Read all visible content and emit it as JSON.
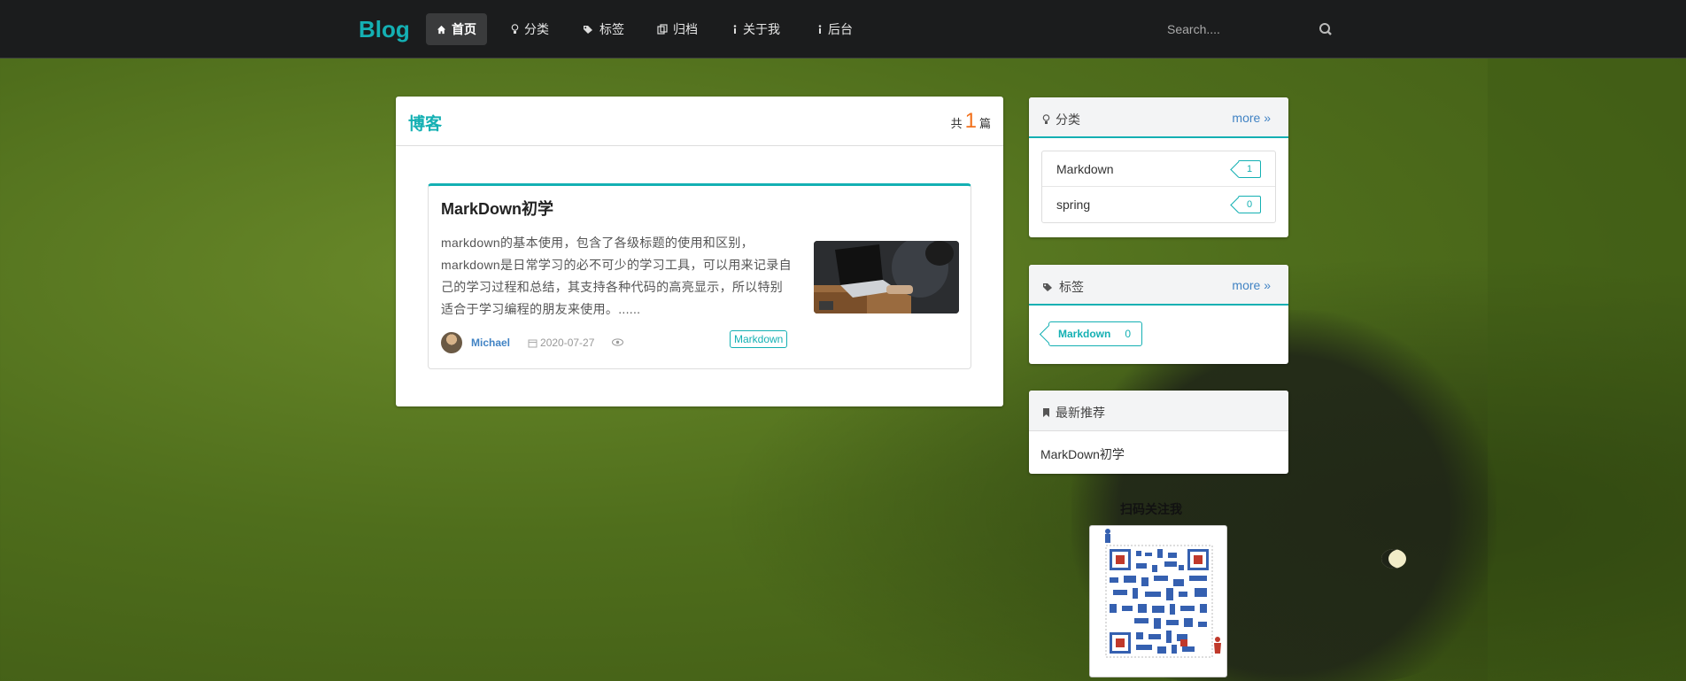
{
  "navbar": {
    "brand": "Blog",
    "items": [
      {
        "label": "首页",
        "icon": "home-icon",
        "active": true
      },
      {
        "label": "分类",
        "icon": "lightbulb-icon"
      },
      {
        "label": "标签",
        "icon": "tags-icon"
      },
      {
        "label": "归档",
        "icon": "clone-icon"
      },
      {
        "label": "关于我",
        "icon": "info-icon"
      },
      {
        "label": "后台",
        "icon": "info-icon"
      }
    ],
    "search_placeholder": "Search...."
  },
  "main": {
    "title": "博客",
    "count_prefix": "共",
    "count": "1",
    "count_suffix": "篇",
    "post": {
      "title": "MarkDown初学",
      "description": "markdown的基本使用，包含了各级标题的使用和区别，markdown是日常学习的必不可少的学习工具，可以用来记录自己的学习过程和总结，其支持各种代码的高亮显示，所以特别适合于学习编程的朋友来使用。......",
      "author": "Michael",
      "date": "2020-07-27",
      "tag": "Markdown"
    }
  },
  "sidebar": {
    "categories": {
      "title": "分类",
      "more": "more",
      "items": [
        {
          "name": "Markdown",
          "count": "1"
        },
        {
          "name": "spring",
          "count": "0"
        }
      ]
    },
    "tags": {
      "title": "标签",
      "more": "more",
      "items": [
        {
          "name": "Markdown",
          "count": "0"
        }
      ]
    },
    "recommend": {
      "title": "最新推荐",
      "items": [
        "MarkDown初学"
      ]
    },
    "qr_label": "扫码关注我"
  },
  "colors": {
    "accent": "#14b0b3",
    "link": "#4183c4",
    "navbar_bg": "#1b1c1d",
    "count_orange": "#f2711c"
  }
}
